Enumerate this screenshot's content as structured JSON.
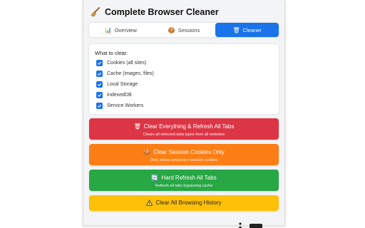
{
  "app": {
    "title": "Complete Browser Cleaner",
    "icon": "broom-icon"
  },
  "tabs": [
    {
      "label": "Overview",
      "icon": "chart-icon",
      "glyph": "📊",
      "active": false
    },
    {
      "label": "Sessions",
      "icon": "cookie-icon",
      "glyph": "🍪",
      "active": false
    },
    {
      "label": "Cleaner",
      "icon": "wastebasket-icon",
      "glyph": "🗑",
      "active": true
    }
  ],
  "clear_panel": {
    "title": "What to clear:",
    "options": [
      {
        "label": "Cookies (all sites)",
        "checked": true
      },
      {
        "label": "Cache (images, files)",
        "checked": true
      },
      {
        "label": "Local Storage",
        "checked": true
      },
      {
        "label": "IndexedDB",
        "checked": true
      },
      {
        "label": "Service Workers",
        "checked": true
      }
    ]
  },
  "actions": [
    {
      "label": "Clear Everything & Refresh All Tabs",
      "subtitle": "Clears all selected data types from all websites",
      "glyph": "🗑",
      "icon": "wastebasket-icon",
      "color": "#dc3545"
    },
    {
      "label": "Clear Session Cookies Only",
      "subtitle": "Only clears temporary session cookies",
      "glyph": "🍪",
      "icon": "cookie-icon",
      "color": "#fd7e14"
    },
    {
      "label": "Hard Refresh All Tabs",
      "subtitle": "Refresh all tabs bypassing cache",
      "glyph": "🔄",
      "icon": "refresh-icon",
      "color": "#28a745"
    },
    {
      "label": "Clear All Browsing History",
      "subtitle": "",
      "icon": "warning-icon",
      "color": "#ffc107"
    }
  ],
  "colors": {
    "accent": "#1a73e8",
    "background": "#f3f4f6"
  }
}
